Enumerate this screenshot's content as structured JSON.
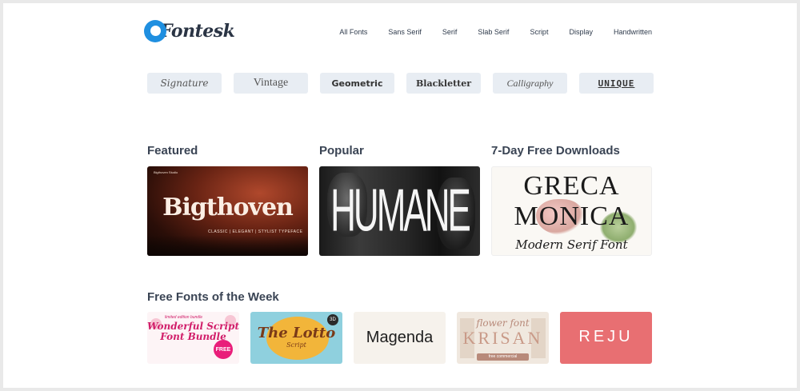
{
  "logo": {
    "text": "Fontesk"
  },
  "nav": [
    "All Fonts",
    "Sans Serif",
    "Serif",
    "Slab Serif",
    "Script",
    "Display",
    "Handwritten"
  ],
  "categories": [
    "Signature",
    "Vintage",
    "Geometric",
    "Blackletter",
    "Calligraphy",
    "UNIQUE"
  ],
  "sections": {
    "featured": "Featured",
    "popular": "Popular",
    "free7": "7-Day Free Downloads",
    "week": "Free Fonts of the Week"
  },
  "cards": {
    "featured": {
      "word": "Bigthoven",
      "sub": "CLASSIC | ELEGANT | STYLIST TYPEFACE",
      "tag": "Bigthoven Studio"
    },
    "popular": {
      "word": "HUMANE"
    },
    "free7": {
      "line1": "GRECA",
      "line2": "MONICA",
      "line3": "Modern Serif Font"
    },
    "week": [
      {
        "title": "Wonderful Script Font Bundle",
        "tag": "limited edition bundle",
        "badge": "FREE"
      },
      {
        "title": "The Lotto",
        "sub": "Script",
        "num": "3D"
      },
      {
        "title": "Magenda"
      },
      {
        "script": "flower font",
        "title": "KRISAN",
        "foot": "free commercial"
      },
      {
        "title": "REJU"
      }
    ]
  }
}
